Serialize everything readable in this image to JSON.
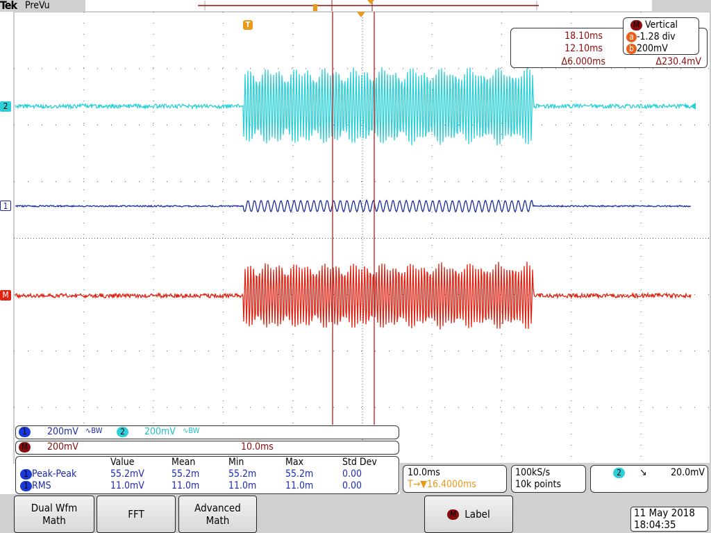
{
  "brand": "Tek",
  "mode": "PreVu",
  "cursor_readout": {
    "title": "Vertical",
    "t1": "18.10ms",
    "t2": "12.10ms",
    "dt": "Δ6.000ms",
    "a_val": "-1.28 div",
    "b_val": "200mV",
    "dv": "Δ230.4mV",
    "a_label": "a",
    "b_label": "b",
    "m_label": "M"
  },
  "channels": {
    "ch1": {
      "num": "1",
      "scale": "200mV",
      "bw": "∿BW"
    },
    "ch2": {
      "num": "2",
      "scale": "200mV",
      "bw": "∿BW"
    },
    "math": {
      "label": "M",
      "scale": "200mV",
      "time": "10.0ms"
    }
  },
  "markers": {
    "ch2": "2",
    "ch1": "1",
    "math": "M",
    "trigger": "T"
  },
  "measurements": {
    "headers": [
      "Value",
      "Mean",
      "Min",
      "Max",
      "Std Dev"
    ],
    "rows": [
      {
        "ch": "1",
        "name": "Peak-Peak",
        "value": "55.2mV",
        "mean": "55.2m",
        "min": "55.2m",
        "max": "55.2m",
        "std": "0.00"
      },
      {
        "ch": "1",
        "name": "RMS",
        "value": "11.0mV",
        "mean": "11.0m",
        "min": "11.0m",
        "max": "11.0m",
        "std": "0.00"
      }
    ]
  },
  "horizontal": {
    "scale": "10.0ms",
    "delay": "16.4000ms",
    "delay_prefix": "T→▼"
  },
  "acquisition": {
    "rate": "100kS/s",
    "points": "10k points"
  },
  "trigger": {
    "ch": "2",
    "slope": "↘",
    "level": "20.0mV"
  },
  "buttons": {
    "dual": "Dual Wfm Math",
    "fft": "FFT",
    "adv": "Advanced Math",
    "label": "Label",
    "label_ch": "M"
  },
  "datetime": {
    "date": "11 May 2018",
    "time": "18:04:35"
  },
  "colors": {
    "ch1": "#1a2a9a",
    "ch2": "#28d0d8",
    "math": "#e02010",
    "cursor": "#a02020",
    "trigger": "#e89a18"
  }
}
